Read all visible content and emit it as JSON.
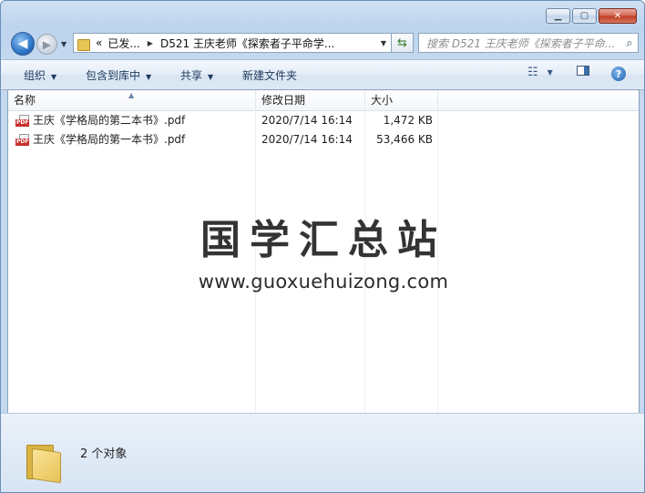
{
  "window": {
    "caption_buttons": {
      "minimize": "▭",
      "maximize": "▢",
      "close": "✕"
    }
  },
  "nav": {
    "address": {
      "overflow": "«",
      "segments": [
        "已发...",
        "D521 王庆老师《探索者子平命学..."
      ]
    },
    "search": {
      "placeholder": "搜索 D521 王庆老师《探索者子平命..."
    }
  },
  "toolbar": {
    "organize": "组织",
    "include_in_library": "包含到库中",
    "share": "共享",
    "new_folder": "新建文件夹"
  },
  "columns": {
    "name": "名称",
    "date": "修改日期",
    "size": "大小"
  },
  "files": [
    {
      "name": "王庆《学格局的第二本书》.pdf",
      "date": "2020/7/14 16:14",
      "size": "1,472 KB",
      "icon": "pdf-icon"
    },
    {
      "name": "王庆《学格局的第一本书》.pdf",
      "date": "2020/7/14 16:14",
      "size": "53,466 KB",
      "icon": "pdf-icon"
    }
  ],
  "watermark": {
    "title": "国学汇总站",
    "url": "www.guoxuehuizong.com"
  },
  "details": {
    "count": "2 个对象"
  },
  "colors": {
    "accent": "#1e395b",
    "pdf_badge": "#c9302c",
    "folder": "#e6c255"
  }
}
